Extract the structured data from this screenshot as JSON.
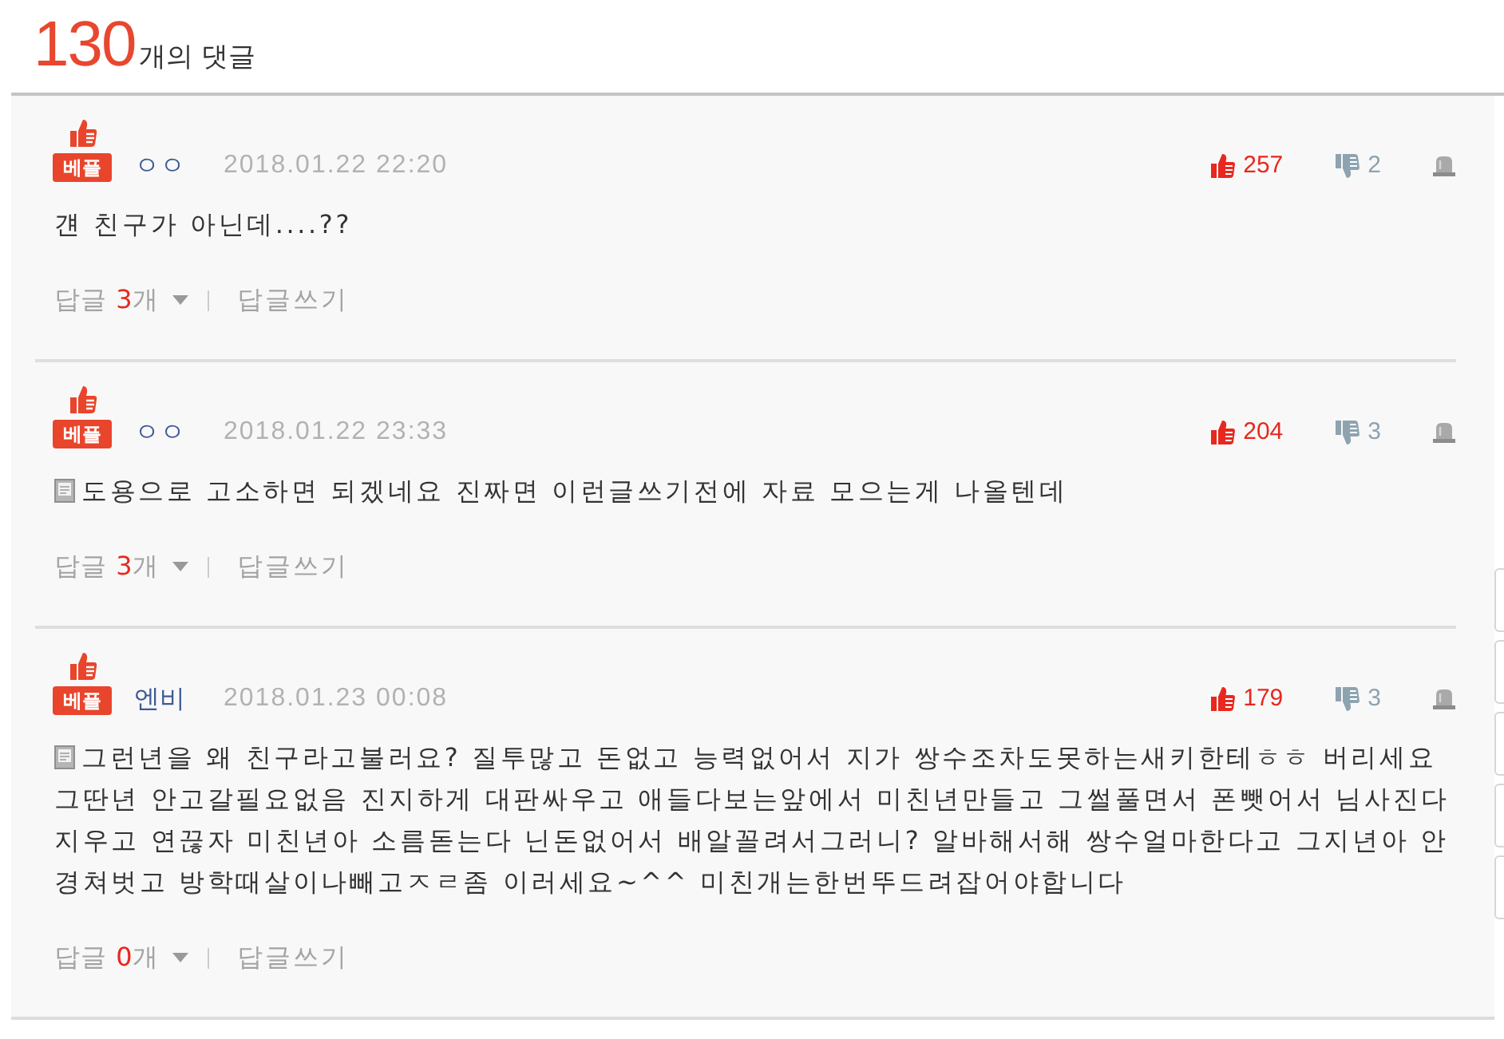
{
  "header": {
    "count": "130",
    "label": "개의 댓글"
  },
  "comments": [
    {
      "badge": "베플",
      "author": "ㅇㅇ",
      "date": "2018.01.22 22:20",
      "likes": "257",
      "dislikes": "2",
      "note_icon": false,
      "text_lines": [
        "걘 친구가 아닌데....??"
      ],
      "replies": {
        "label": "답글",
        "count": "3",
        "unit": "개",
        "expanded": false
      },
      "write_reply": "답글쓰기"
    },
    {
      "badge": "베플",
      "author": "ㅇㅇ",
      "date": "2018.01.22 23:33",
      "likes": "204",
      "dislikes": "3",
      "note_icon": true,
      "text_lines": [
        "도용으로 고소하면 되겠네요 진짜면 이런글쓰기전에 자료 모으는게 나올텐데"
      ],
      "replies": {
        "label": "답글",
        "count": "3",
        "unit": "개",
        "expanded": false
      },
      "write_reply": "답글쓰기"
    },
    {
      "badge": "베플",
      "author": "엔비",
      "date": "2018.01.23 00:08",
      "likes": "179",
      "dislikes": "3",
      "note_icon": true,
      "text_lines": [
        "그런년을 왜 친구라고불러요? 질투많고 돈없고 능력없어서 지가 쌍수조차도못하는새키한테ㅎㅎ 버리세요",
        "그딴년 안고갈필요없음 진지하게 대판싸우고 애들다보는앞에서 미친년만들고 그썰풀면서 폰뺏어서 님사진다",
        "지우고 연끊자 미친년아 소름돋는다 닌돈없어서 배알꼴려서그러니? 알바해서해 쌍수얼마한다고 그지년아 안",
        "경쳐벗고 방학때살이나빼고ㅈㄹ좀 이러세요~^^ 미친개는한번뚜드려잡어야합니다"
      ],
      "replies": {
        "label": "답글",
        "count": "0",
        "unit": "개",
        "expanded": false
      },
      "write_reply": "답글쓰기"
    }
  ]
}
